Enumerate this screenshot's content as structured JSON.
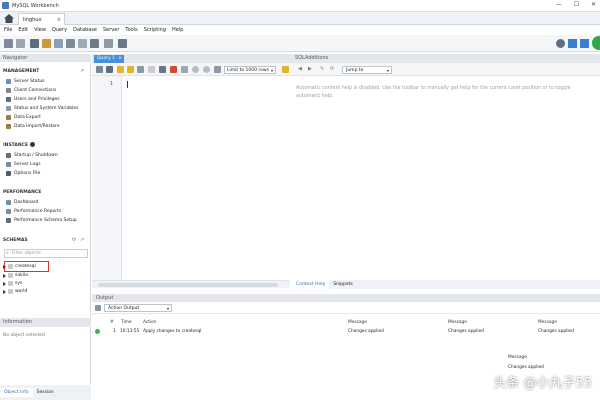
{
  "window": {
    "title": "MySQL Workbench",
    "controls": [
      "—",
      "☐",
      "✕"
    ]
  },
  "connection_tab": {
    "label": "linghuo",
    "close": "×"
  },
  "menu": [
    "File",
    "Edit",
    "View",
    "Query",
    "Database",
    "Server",
    "Tools",
    "Scripting",
    "Help"
  ],
  "navigator": {
    "header": "Navigator",
    "management": {
      "title": "MANAGEMENT",
      "items": [
        "Server Status",
        "Client Connections",
        "Users and Privileges",
        "Status and System Variables",
        "Data Export",
        "Data Import/Restore"
      ]
    },
    "instance": {
      "title": "INSTANCE",
      "items": [
        "Startup / Shutdown",
        "Server Logs",
        "Options File"
      ]
    },
    "performance": {
      "title": "PERFORMANCE",
      "items": [
        "Dashboard",
        "Performance Reports",
        "Performance Schema Setup"
      ]
    },
    "schemas": {
      "title": "SCHEMAS",
      "filter_placeholder": "Filter objects",
      "items": [
        "createsql",
        "sakila",
        "sys",
        "world"
      ]
    }
  },
  "information": {
    "header": "Information",
    "body": "No object selected"
  },
  "bottom_tabs": [
    "Object Info",
    "Session"
  ],
  "query": {
    "tab_label": "Query 1",
    "tab_close": "×",
    "limit": "Limit to 1000 rows",
    "line_number": "1"
  },
  "sql_additions": {
    "header": "SQLAdditions",
    "jump_to": "Jump to",
    "help_text": "Automatic context help is disabled. Use the toolbar to manually get help for the current caret position or to toggle automatic help.",
    "tabs": [
      "Context Help",
      "Snippets"
    ]
  },
  "output": {
    "header": "Output",
    "selector": "Action Output",
    "columns": {
      "num": "#",
      "time": "Time",
      "action": "Action",
      "message": "Message"
    },
    "row": {
      "num": "1",
      "time": "10:13:55",
      "action": "Apply changes to createsql",
      "messages": [
        "Changes applied",
        "Changes applied",
        "Changes applied",
        "Changes applied"
      ]
    }
  },
  "watermark": "头条 @小丸子55",
  "colors": {
    "accent": "#4a90d9",
    "selection_box": "#e0302a",
    "success": "#3bb34a"
  }
}
